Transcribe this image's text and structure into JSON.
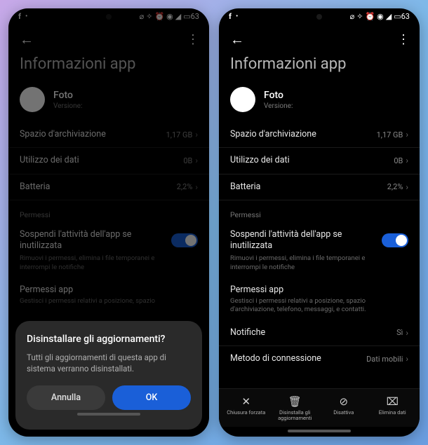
{
  "status": {
    "battery": "63"
  },
  "page_title": "Informazioni app",
  "app": {
    "name": "Foto",
    "version_label": "Versione:"
  },
  "rows": {
    "storage": {
      "label": "Spazio d'archiviazione",
      "value": "1,17 GB"
    },
    "data": {
      "label": "Utilizzo dei dati",
      "value": "0B"
    },
    "battery": {
      "label": "Batteria",
      "value": "2,2%"
    }
  },
  "permissions_section": "Permessi",
  "suspend": {
    "title": "Sospendi l'attività dell'app se inutilizzata",
    "desc_short": "Rimuovi i permessi, elimina i file temporanei e interrompi le notifiche",
    "desc_trunc": "Rimuovi i permessi, elimina i file temporanei e interrompi le notifiche"
  },
  "perms_app": {
    "title": "Permessi app",
    "desc_trunc": "Gestisci i permessi relativi a posizione, spazio",
    "desc_full": "Gestisci i permessi relativi a posizione, spazio d'archiviazione, telefono, messaggi, e contatti."
  },
  "notifications": {
    "label": "Notifiche",
    "value": "Sì"
  },
  "connection": {
    "label": "Metodo di connessione",
    "value": "Dati mobili"
  },
  "dialog": {
    "title": "Disinstallare gli aggiornamenti?",
    "message": "Tutti gli aggiornamenti di questa app di sistema verranno disinstallati.",
    "cancel": "Annulla",
    "ok": "OK"
  },
  "bottom": {
    "force_stop": "Chiusura forzata",
    "uninstall_updates": "Disinstalla gli aggiornamenti",
    "disable": "Disattiva",
    "clear_data": "Elimina dati"
  }
}
